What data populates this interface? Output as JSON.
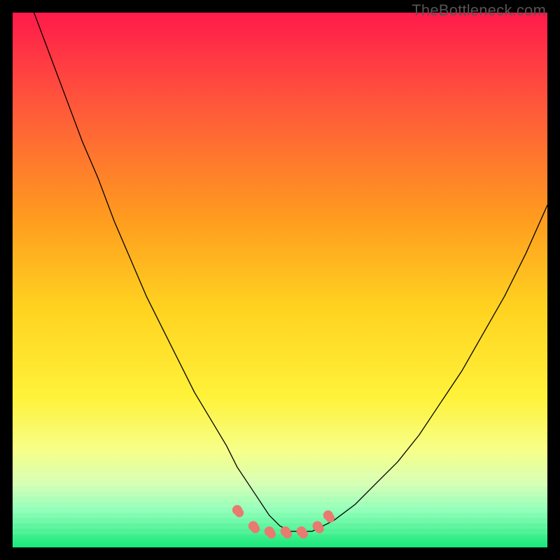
{
  "watermark": "TheBottleneck.com",
  "chart_data": {
    "type": "line",
    "title": "",
    "xlabel": "",
    "ylabel": "",
    "xlim": [
      0,
      100
    ],
    "ylim": [
      0,
      100
    ],
    "grid": false,
    "legend": false,
    "background": {
      "type": "vertical-gradient",
      "stops": [
        {
          "offset": 0.0,
          "color": "#ff1a4b"
        },
        {
          "offset": 0.18,
          "color": "#ff5a3a"
        },
        {
          "offset": 0.38,
          "color": "#ff9a1f"
        },
        {
          "offset": 0.55,
          "color": "#ffd21f"
        },
        {
          "offset": 0.72,
          "color": "#fff23a"
        },
        {
          "offset": 0.82,
          "color": "#f6ff8a"
        },
        {
          "offset": 0.88,
          "color": "#d6ffb3"
        },
        {
          "offset": 0.93,
          "color": "#8fffb8"
        },
        {
          "offset": 1.0,
          "color": "#17e879"
        }
      ]
    },
    "series": [
      {
        "name": "bottleneck-curve",
        "stroke": "#000000",
        "stroke_width": 1.3,
        "x": [
          4,
          7,
          10,
          13,
          16,
          19,
          22,
          25,
          28,
          31,
          34,
          37,
          40,
          42,
          44,
          46,
          48,
          50,
          52,
          54,
          56,
          58,
          60,
          64,
          68,
          72,
          76,
          80,
          84,
          88,
          92,
          96,
          100
        ],
        "values": [
          100,
          92,
          84,
          76,
          69,
          61,
          54,
          47,
          41,
          35,
          29,
          24,
          19,
          15,
          12,
          9,
          6,
          4,
          3,
          3,
          3,
          4,
          5,
          8,
          12,
          16,
          21,
          27,
          33,
          40,
          47,
          55,
          64
        ]
      },
      {
        "name": "optimal-markers",
        "type": "markers",
        "marker_color": "#e87a6f",
        "marker_radius_px": 7,
        "x": [
          42,
          45,
          48,
          51,
          54,
          57,
          59
        ],
        "values": [
          7,
          4,
          3,
          3,
          3,
          4,
          6
        ]
      }
    ]
  }
}
